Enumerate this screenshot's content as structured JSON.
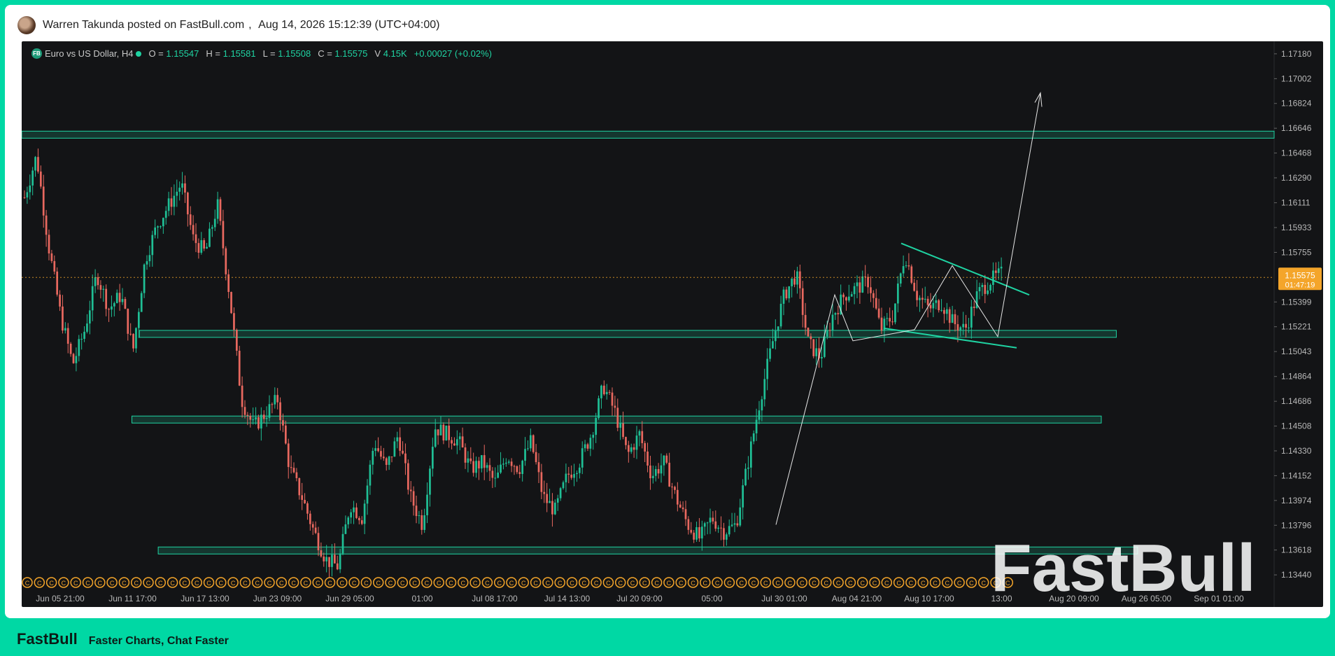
{
  "post": {
    "author_line": "Warren Takunda posted on FastBull.com",
    "separator": ",",
    "timestamp": "Aug 14, 2026 15:12:39 (UTC+04:00)"
  },
  "legend": {
    "badge": "FB",
    "symbol": "Euro vs US Dollar, H4",
    "o_label": "O =",
    "o": "1.15547",
    "h_label": "H =",
    "h": "1.15581",
    "l_label": "L =",
    "l": "1.15508",
    "c_label": "C =",
    "c": "1.15575",
    "v_label": "V",
    "v": "4.15K",
    "change": "+0.00027 (+0.02%)"
  },
  "watermark": "FastBull",
  "footer": {
    "logo": "FastBull",
    "tagline": "Faster Charts, Chat Faster"
  },
  "colors": {
    "up": "#1fbf95",
    "down": "#e8685f",
    "zone": "#1fd3a2",
    "price_tag": "#f4a52a",
    "brand": "#00d8a4"
  },
  "chart_data": {
    "type": "candlestick",
    "price_label": {
      "value": "1.15575",
      "countdown": "01:47:19"
    },
    "y_ticks": [
      "1.17180",
      "1.17002",
      "1.16824",
      "1.16646",
      "1.16468",
      "1.16290",
      "1.16111",
      "1.15933",
      "1.15755",
      "1.15399",
      "1.15221",
      "1.15043",
      "1.14864",
      "1.14686",
      "1.14508",
      "1.14330",
      "1.14152",
      "1.13974",
      "1.13796",
      "1.13618",
      "1.13440"
    ],
    "ylim": [
      1.1335,
      1.1727
    ],
    "x_ticks": [
      "Jun 05 21:00",
      "Jun 11 17:00",
      "Jun 17 13:00",
      "Jun 23 09:00",
      "Jun 29 05:00",
      "01:00",
      "Jul 08 17:00",
      "Jul 14 13:00",
      "Jul 20 09:00",
      "05:00",
      "Jul 30 01:00",
      "Aug 04 21:00",
      "Aug 10 17:00",
      "13:00",
      "Aug 20 09:00",
      "Aug 26 05:00",
      "Sep 01 01:00"
    ],
    "candle_path": [
      1.1615,
      1.1645,
      1.158,
      1.153,
      1.1495,
      1.152,
      1.156,
      1.1535,
      1.1545,
      1.1505,
      1.157,
      1.1595,
      1.161,
      1.1625,
      1.1585,
      1.1575,
      1.161,
      1.1545,
      1.147,
      1.145,
      1.146,
      1.147,
      1.142,
      1.14,
      1.1375,
      1.1355,
      1.135,
      1.1395,
      1.1385,
      1.144,
      1.142,
      1.1445,
      1.14,
      1.138,
      1.145,
      1.1445,
      1.144,
      1.142,
      1.1425,
      1.141,
      1.143,
      1.142,
      1.144,
      1.14,
      1.139,
      1.1415,
      1.1425,
      1.1445,
      1.148,
      1.146,
      1.143,
      1.1445,
      1.1415,
      1.1425,
      1.14,
      1.138,
      1.137,
      1.1385,
      1.1375,
      1.138,
      1.1425,
      1.147,
      1.151,
      1.1545,
      1.156,
      1.151,
      1.15,
      1.153,
      1.1545,
      1.155,
      1.1555,
      1.152,
      1.153,
      1.1575,
      1.1545,
      1.1535,
      1.154,
      1.1525,
      1.152,
      1.1545,
      1.1555,
      1.156
    ],
    "zones": [
      {
        "low": 1.16575,
        "high": 1.16625,
        "from": 0.0,
        "to": 1.0
      },
      {
        "low": 1.1516,
        "high": 1.15195,
        "from": 0.094,
        "to": 0.874
      },
      {
        "low": 1.1454,
        "high": 1.1458,
        "from": 0.088,
        "to": 0.862
      },
      {
        "low": 1.136,
        "high": 1.1364,
        "from": 0.109,
        "to": 0.891
      }
    ],
    "earnings_markers": "C"
  }
}
